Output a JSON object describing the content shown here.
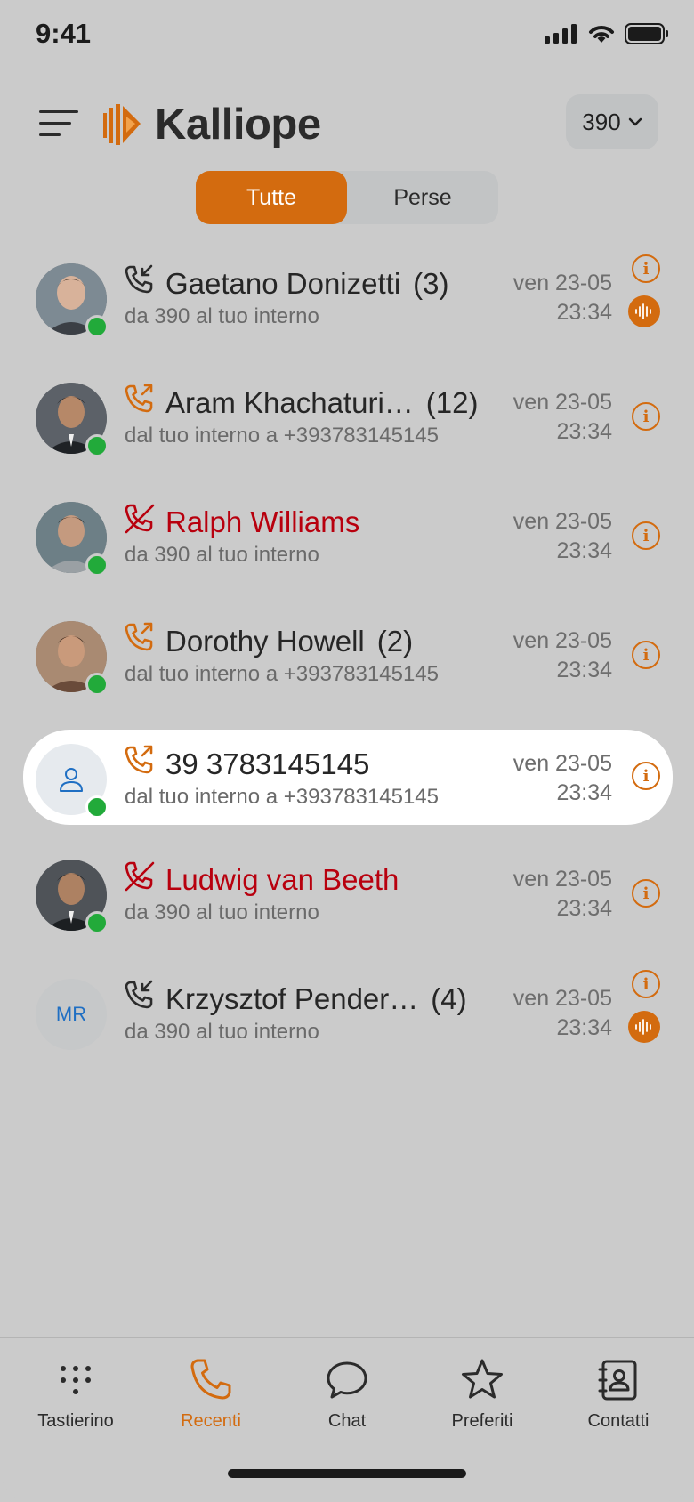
{
  "status_bar": {
    "time": "9:41"
  },
  "header": {
    "logo_text": "Kalliope",
    "extension_value": "390"
  },
  "filters": {
    "all_label": "Tutte",
    "missed_label": "Perse"
  },
  "calls": [
    {
      "name": "Gaetano Donizetti",
      "count": "(3)",
      "description": "da 390 al tuo interno",
      "date": "ven 23-05",
      "time": "23:34",
      "direction": "incoming",
      "missed": false,
      "has_recording": true,
      "avatar": "photo"
    },
    {
      "name": "Aram Khachaturi…",
      "count": "(12)",
      "description": "dal tuo interno a +393783145145",
      "date": "ven 23-05",
      "time": "23:34",
      "direction": "outgoing",
      "missed": false,
      "has_recording": false,
      "avatar": "photo"
    },
    {
      "name": "Ralph Williams",
      "count": "",
      "description": "da 390 al tuo interno",
      "date": "ven 23-05",
      "time": "23:34",
      "direction": "missed",
      "missed": true,
      "has_recording": false,
      "avatar": "photo"
    },
    {
      "name": "Dorothy Howell",
      "count": "(2)",
      "description": "dal tuo interno a +393783145145",
      "date": "ven 23-05",
      "time": "23:34",
      "direction": "outgoing",
      "missed": false,
      "has_recording": false,
      "avatar": "photo"
    },
    {
      "name": "39 3783145145",
      "count": "",
      "description": "dal tuo interno a +393783145145",
      "date": "ven 23-05",
      "time": "23:34",
      "direction": "outgoing",
      "missed": false,
      "has_recording": false,
      "avatar": "generic"
    },
    {
      "name": "Ludwig van Beeth",
      "count": "",
      "description": "da 390 al tuo interno",
      "date": "ven 23-05",
      "time": "23:34",
      "direction": "missed",
      "missed": true,
      "has_recording": false,
      "avatar": "photo"
    },
    {
      "name": "Krzysztof Pender…",
      "count": "(4)",
      "description": "da 390 al tuo interno",
      "date": "ven 23-05",
      "time": "23:34",
      "direction": "incoming",
      "missed": false,
      "has_recording": true,
      "avatar": "initials",
      "initials": "MR"
    }
  ],
  "tabbar": {
    "keypad": "Tastierino",
    "recents": "Recenti",
    "chat": "Chat",
    "favorites": "Preferiti",
    "contacts": "Contatti"
  },
  "colors": {
    "accent": "#d36b0f",
    "missed": "#b8000e",
    "presence": "#22aa3a",
    "background": "#cbcbcb"
  }
}
